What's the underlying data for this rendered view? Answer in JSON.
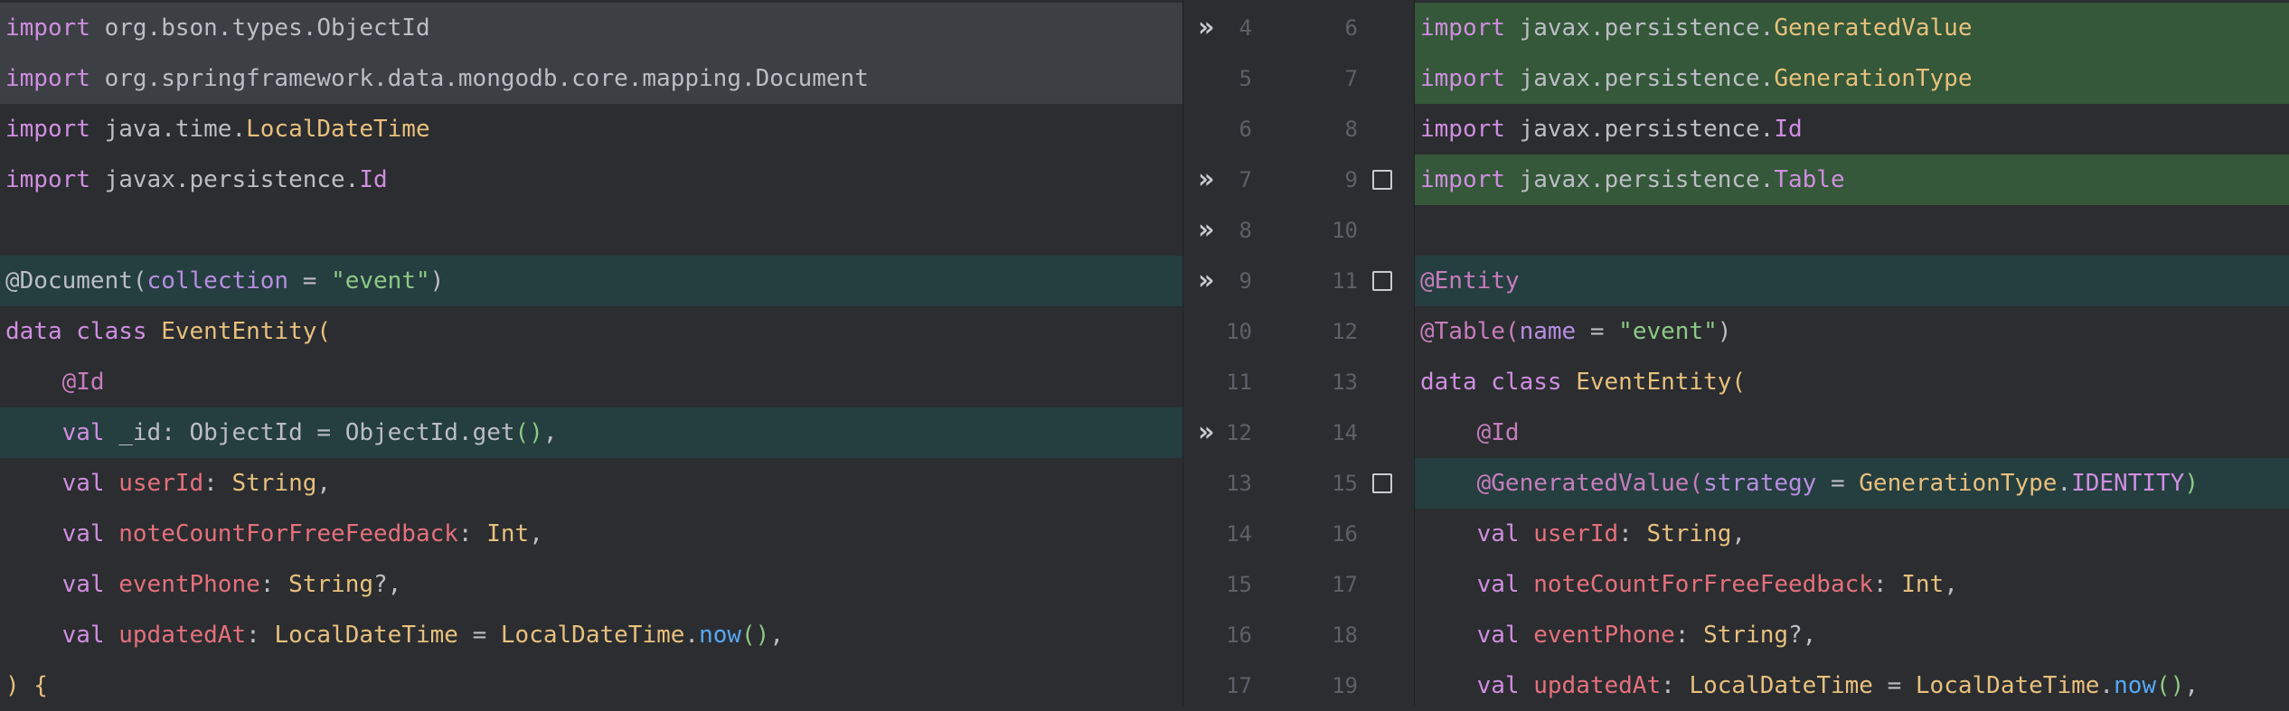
{
  "left": {
    "lines": [
      {
        "parts": [
          [
            "kw",
            "import"
          ],
          [
            "pk",
            " org.bson.types.ObjectId"
          ]
        ]
      },
      {
        "parts": [
          [
            "kw",
            "import"
          ],
          [
            "pk",
            " org.springframework.data.mongodb.core.mapping.Document"
          ]
        ]
      },
      {
        "parts": [
          [
            "kw",
            "import"
          ],
          [
            "pk",
            " java.time."
          ],
          [
            "cls",
            "LocalDateTime"
          ]
        ]
      },
      {
        "parts": [
          [
            "kw",
            "import"
          ],
          [
            "pk",
            " javax.persistence."
          ],
          [
            "kw",
            "Id"
          ]
        ]
      },
      {
        "parts": []
      },
      {
        "parts": [
          [
            "pk",
            "@Document("
          ],
          [
            "par",
            "collection"
          ],
          [
            "pk",
            " = "
          ],
          [
            "str",
            "\"event\""
          ],
          [
            "pk",
            ")"
          ]
        ]
      },
      {
        "parts": [
          [
            "kw",
            "data class "
          ],
          [
            "cls",
            "EventEntity("
          ]
        ]
      },
      {
        "parts": [
          [
            "ann",
            "    @Id"
          ]
        ]
      },
      {
        "parts": [
          [
            "kw",
            "    val "
          ],
          [
            "pk",
            "_id: ObjectId = ObjectId.get"
          ],
          [
            "str",
            "()"
          ],
          [
            "pk",
            ","
          ]
        ]
      },
      {
        "parts": [
          [
            "kw",
            "    val "
          ],
          [
            "prop",
            "userId"
          ],
          [
            "pk",
            ": "
          ],
          [
            "cls",
            "String"
          ],
          [
            "pk",
            ","
          ]
        ]
      },
      {
        "parts": [
          [
            "kw",
            "    val "
          ],
          [
            "prop",
            "noteCountForFreeFeedback"
          ],
          [
            "pk",
            ": "
          ],
          [
            "cls",
            "Int"
          ],
          [
            "pk",
            ","
          ]
        ]
      },
      {
        "parts": [
          [
            "kw",
            "    val "
          ],
          [
            "prop",
            "eventPhone"
          ],
          [
            "pk",
            ": "
          ],
          [
            "cls",
            "String"
          ],
          [
            "pk",
            "?,"
          ]
        ]
      },
      {
        "parts": [
          [
            "kw",
            "    val "
          ],
          [
            "prop",
            "updatedAt"
          ],
          [
            "pk",
            ": "
          ],
          [
            "cls",
            "LocalDateTime"
          ],
          [
            "pk",
            " = "
          ],
          [
            "cls",
            "LocalDateTime"
          ],
          [
            "pk",
            "."
          ],
          [
            "fn",
            "now"
          ],
          [
            "str",
            "()"
          ],
          [
            "pk",
            ","
          ]
        ]
      },
      {
        "parts": [
          [
            "cls",
            ") {"
          ]
        ]
      }
    ]
  },
  "right": {
    "lines": [
      {
        "parts": [
          [
            "kw",
            "import"
          ],
          [
            "pk",
            " javax.persistence."
          ],
          [
            "cls",
            "GeneratedValue"
          ]
        ]
      },
      {
        "parts": [
          [
            "kw",
            "import"
          ],
          [
            "pk",
            " javax.persistence."
          ],
          [
            "cls",
            "GenerationType"
          ]
        ]
      },
      {
        "parts": [
          [
            "kw",
            "import"
          ],
          [
            "pk",
            " javax.persistence."
          ],
          [
            "kw",
            "Id"
          ]
        ]
      },
      {
        "parts": [
          [
            "kw",
            "import"
          ],
          [
            "pk",
            " javax.persistence."
          ],
          [
            "kw",
            "Table"
          ]
        ]
      },
      {
        "parts": []
      },
      {
        "parts": [
          [
            "ann",
            "@Entity"
          ]
        ]
      },
      {
        "parts": [
          [
            "ann",
            "@Table("
          ],
          [
            "par",
            "name"
          ],
          [
            "pk",
            " = "
          ],
          [
            "str",
            "\"event\""
          ],
          [
            "pk",
            ")"
          ]
        ]
      },
      {
        "parts": [
          [
            "kw",
            "data class "
          ],
          [
            "cls",
            "EventEntity("
          ]
        ]
      },
      {
        "parts": [
          [
            "ann",
            "    @Id"
          ]
        ]
      },
      {
        "parts": [
          [
            "ann",
            "    @GeneratedValue("
          ],
          [
            "par",
            "strategy"
          ],
          [
            "pk",
            " = "
          ],
          [
            "cls",
            "GenerationType"
          ],
          [
            "pk",
            "."
          ],
          [
            "kw",
            "IDENTITY"
          ],
          [
            "str",
            ")"
          ]
        ]
      },
      {
        "parts": [
          [
            "kw",
            "    val "
          ],
          [
            "prop",
            "userId"
          ],
          [
            "pk",
            ": "
          ],
          [
            "cls",
            "String"
          ],
          [
            "pk",
            ","
          ]
        ]
      },
      {
        "parts": [
          [
            "kw",
            "    val "
          ],
          [
            "prop",
            "noteCountForFreeFeedback"
          ],
          [
            "pk",
            ": "
          ],
          [
            "cls",
            "Int"
          ],
          [
            "pk",
            ","
          ]
        ]
      },
      {
        "parts": [
          [
            "kw",
            "    val "
          ],
          [
            "prop",
            "eventPhone"
          ],
          [
            "pk",
            ": "
          ],
          [
            "cls",
            "String"
          ],
          [
            "pk",
            "?,"
          ]
        ]
      },
      {
        "parts": [
          [
            "kw",
            "    val "
          ],
          [
            "prop",
            "updatedAt"
          ],
          [
            "pk",
            ": "
          ],
          [
            "cls",
            "LocalDateTime"
          ],
          [
            "pk",
            " = "
          ],
          [
            "cls",
            "LocalDateTime"
          ],
          [
            "pk",
            "."
          ],
          [
            "fn",
            "now"
          ],
          [
            "str",
            "()"
          ],
          [
            "pk",
            ","
          ]
        ]
      }
    ]
  },
  "gutter": {
    "rows": [
      {
        "left": "4",
        "right": "6",
        "arrow": true,
        "check": false
      },
      {
        "left": "5",
        "right": "7",
        "arrow": false,
        "check": false
      },
      {
        "left": "6",
        "right": "8",
        "arrow": false,
        "check": false
      },
      {
        "left": "7",
        "right": "9",
        "arrow": true,
        "check": true
      },
      {
        "left": "8",
        "right": "10",
        "arrow": true,
        "check": false
      },
      {
        "left": "9",
        "right": "11",
        "arrow": true,
        "check": true
      },
      {
        "left": "10",
        "right": "12",
        "arrow": false,
        "check": false
      },
      {
        "left": "11",
        "right": "13",
        "arrow": false,
        "check": false
      },
      {
        "left": "12",
        "right": "14",
        "arrow": true,
        "check": false
      },
      {
        "left": "13",
        "right": "15",
        "arrow": false,
        "check": true
      },
      {
        "left": "14",
        "right": "16",
        "arrow": false,
        "check": false
      },
      {
        "left": "15",
        "right": "17",
        "arrow": false,
        "check": false
      },
      {
        "left": "16",
        "right": "18",
        "arrow": false,
        "check": false
      },
      {
        "left": "17",
        "right": "19",
        "arrow": false,
        "check": false
      }
    ],
    "arrow_icon": "apply-change-icon",
    "check_icon": "checkbox-icon"
  },
  "colors": {
    "background": "#2b2d30",
    "changed_left": "#3c3f44",
    "added_right": "#345839",
    "modified": "#253e40"
  }
}
